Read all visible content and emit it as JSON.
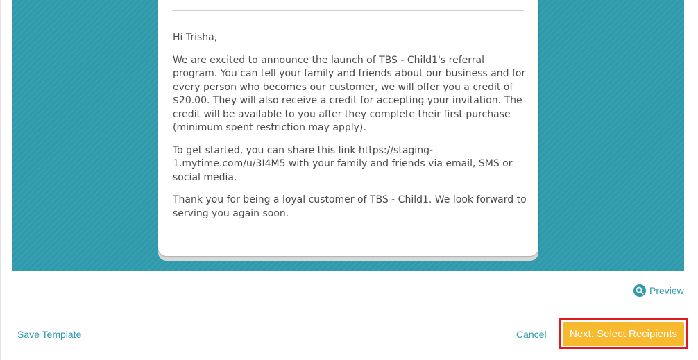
{
  "email": {
    "greeting": "Hi Trisha,",
    "paragraph_1": "We are excited to announce the launch of TBS - Child1's referral program. You can tell your family and friends about our business and for every person who becomes our customer, we will offer you a credit of $20.00. They will also receive a credit for accepting your invitation. The credit will be available to you after they complete their first purchase (minimum spent restriction may apply).",
    "paragraph_2": "To get started, you can share this link https://staging-1.mytime.com/u/3I4M5 with your family and friends via email, SMS or social media.",
    "paragraph_3": "Thank you for being a loyal customer of TBS - Child1. We look forward to serving you again soon."
  },
  "actions": {
    "preview_label": "Preview",
    "preview_icon": "search-icon",
    "save_template_label": "Save Template",
    "cancel_label": "Cancel",
    "next_label": "Next: Select Recipients"
  },
  "colors": {
    "banner": "#2e9aab",
    "link": "#2e9aab",
    "primary_button": "#f7b92e",
    "highlight_outline": "#e0191c"
  }
}
